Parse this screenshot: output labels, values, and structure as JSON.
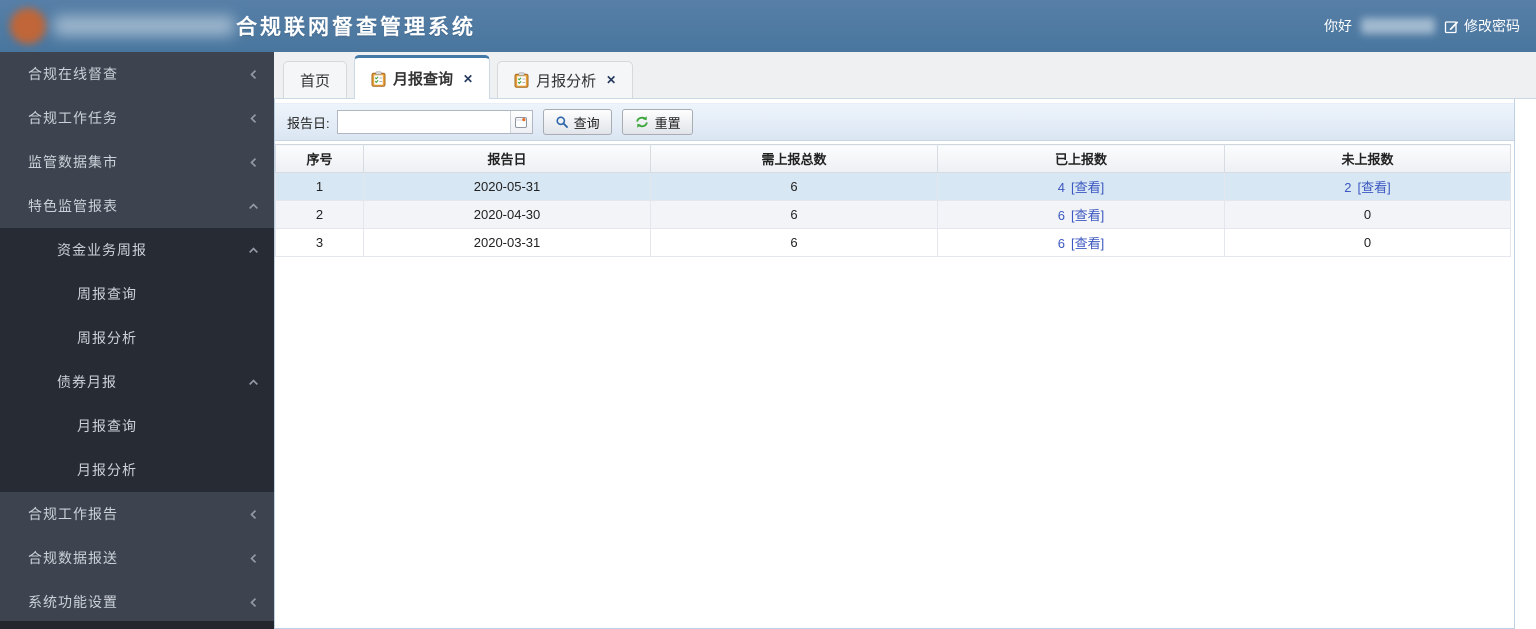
{
  "header": {
    "title": "合规联网督查管理系统",
    "greeting": "你好",
    "change_password": "修改密码",
    "edit_icon": "edit-icon",
    "bg_color": "#4d7ba4"
  },
  "tabs": [
    {
      "label": "首页",
      "active": false,
      "closable": false
    },
    {
      "label": "月报查询",
      "active": true,
      "closable": true,
      "icon": "clipboard-icon"
    },
    {
      "label": "月报分析",
      "active": false,
      "closable": true,
      "icon": "clipboard-icon"
    }
  ],
  "tab_close_glyph": "✕",
  "sidebar": {
    "bg_color": "#3d434f",
    "expanded_bg_color": "#272b33",
    "items": [
      {
        "label": "合规在线督查",
        "level": 1,
        "state": "collapsed"
      },
      {
        "label": "合规工作任务",
        "level": 1,
        "state": "collapsed"
      },
      {
        "label": "监管数据集市",
        "level": 1,
        "state": "collapsed"
      },
      {
        "label": "特色监管报表",
        "level": 1,
        "state": "expanded"
      },
      {
        "label": "资金业务周报",
        "level": 2,
        "state": "expanded",
        "group": "dark"
      },
      {
        "label": "周报查询",
        "level": 3,
        "group": "dark"
      },
      {
        "label": "周报分析",
        "level": 3,
        "group": "dark"
      },
      {
        "label": "债券月报",
        "level": 2,
        "state": "expanded",
        "group": "dark"
      },
      {
        "label": "月报查询",
        "level": 3,
        "group": "dark"
      },
      {
        "label": "月报分析",
        "level": 3,
        "group": "dark"
      },
      {
        "label": "合规工作报告",
        "level": 1,
        "state": "collapsed"
      },
      {
        "label": "合规数据报送",
        "level": 1,
        "state": "collapsed"
      },
      {
        "label": "系统功能设置",
        "level": 1,
        "state": "collapsed"
      }
    ]
  },
  "toolbar": {
    "date_label": "报告日:",
    "date_value": "",
    "date_icon": "calendar-icon",
    "search_label": "查询",
    "search_icon": "magnifier-icon",
    "reset_label": "重置",
    "reset_icon": "refresh-icon"
  },
  "table": {
    "columns": [
      "序号",
      "报告日",
      "需上报总数",
      "已上报数",
      "未上报数"
    ],
    "view_label": "[查看]",
    "link_color": "#3c58c0",
    "selected_row_color": "#d8e7f4",
    "rows": [
      {
        "no": "1",
        "date": "2020-05-31",
        "total": "6",
        "reported": "4",
        "reported_view": true,
        "unreported": "2",
        "unreported_view": true,
        "selected": true
      },
      {
        "no": "2",
        "date": "2020-04-30",
        "total": "6",
        "reported": "6",
        "reported_view": true,
        "unreported": "0",
        "unreported_view": false,
        "selected": false
      },
      {
        "no": "3",
        "date": "2020-03-31",
        "total": "6",
        "reported": "6",
        "reported_view": true,
        "unreported": "0",
        "unreported_view": false,
        "selected": false
      }
    ]
  }
}
